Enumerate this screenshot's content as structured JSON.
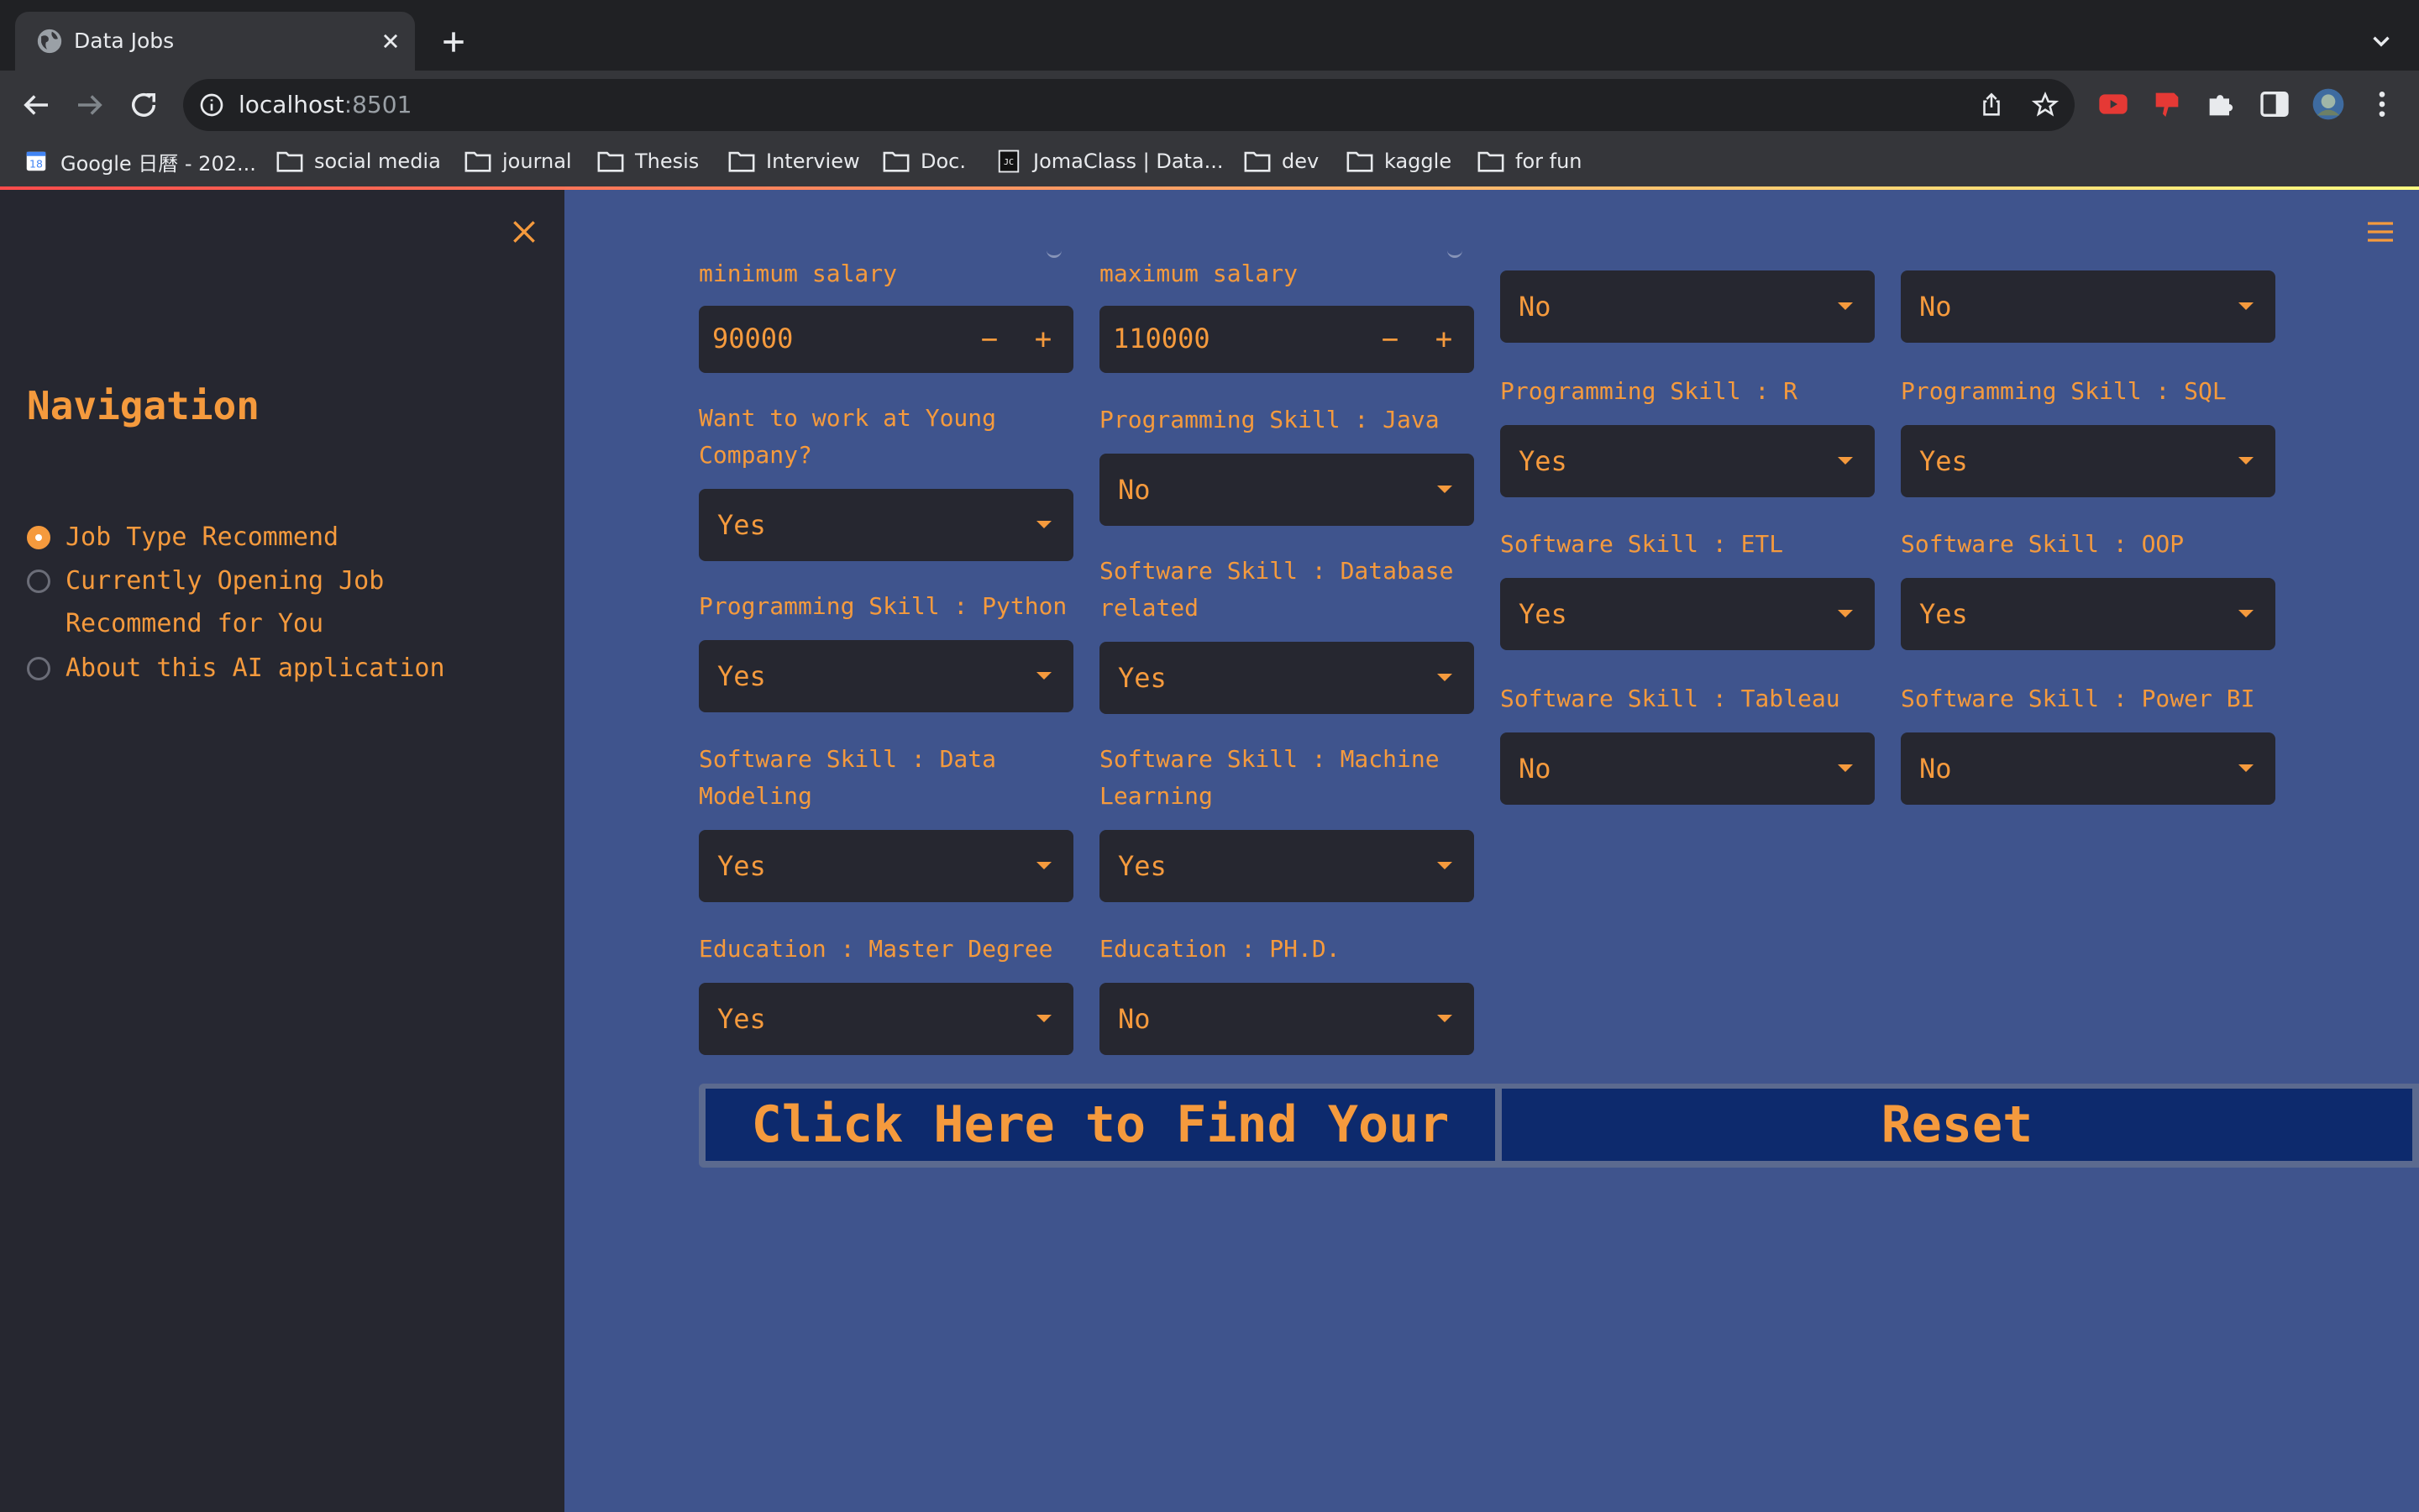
{
  "browser": {
    "tab_title": "Data Jobs",
    "url_host": "localhost",
    "url_port": ":8501",
    "bookmarks": [
      {
        "label": "Google 日曆 - 202...",
        "icon": "calendar-icon"
      },
      {
        "label": "social media",
        "icon": "folder-icon"
      },
      {
        "label": "journal",
        "icon": "folder-icon"
      },
      {
        "label": "Thesis",
        "icon": "folder-icon"
      },
      {
        "label": "Interview",
        "icon": "folder-icon"
      },
      {
        "label": "Doc.",
        "icon": "folder-icon"
      },
      {
        "label": "JomaClass | Data...",
        "icon": "jomaclass-icon"
      },
      {
        "label": "dev",
        "icon": "folder-icon"
      },
      {
        "label": "kaggle",
        "icon": "folder-icon"
      },
      {
        "label": "for fun",
        "icon": "folder-icon"
      }
    ]
  },
  "sidebar": {
    "title": "Navigation",
    "options": [
      {
        "label": "Job Type Recommend",
        "selected": true
      },
      {
        "label": "Currently Opening Job Recommend for You",
        "selected": false
      },
      {
        "label": "About this AI application",
        "selected": false
      }
    ]
  },
  "form": {
    "min_salary": {
      "label": "minimum salary",
      "value": "90000"
    },
    "max_salary": {
      "label": "maximum salary",
      "value": "110000"
    },
    "col3_top": {
      "value": "No"
    },
    "col4_top": {
      "value": "No"
    },
    "young_company": {
      "label": "Want to work at Young Company?",
      "value": "Yes"
    },
    "java": {
      "label": "Programming Skill : Java",
      "value": "No"
    },
    "r": {
      "label": "Programming Skill : R",
      "value": "Yes"
    },
    "sql": {
      "label": "Programming Skill : SQL",
      "value": "Yes"
    },
    "etl": {
      "label": "Software Skill : ETL",
      "value": "Yes"
    },
    "oop": {
      "label": "Software Skill : OOP",
      "value": "Yes"
    },
    "python": {
      "label": "Programming Skill : Python",
      "value": "Yes"
    },
    "database": {
      "label": "Software Skill : Database related",
      "value": "Yes"
    },
    "tableau": {
      "label": "Software Skill : Tableau",
      "value": "No"
    },
    "powerbi": {
      "label": "Software Skill : Power BI",
      "value": "No"
    },
    "data_modeling": {
      "label": "Software Skill : Data Modeling",
      "value": "Yes"
    },
    "ml": {
      "label": "Software Skill : Machine Learning",
      "value": "Yes"
    },
    "master": {
      "label": "Education : Master Degree",
      "value": "Yes"
    },
    "phd": {
      "label": "Education : PH.D.",
      "value": "No"
    }
  },
  "actions": {
    "find_label": "Click Here to Find Your",
    "reset_label": "Reset"
  },
  "colors": {
    "accent": "#f59a3d",
    "main_bg": "#3f548d",
    "sidebar_bg": "#262730",
    "input_bg": "#262730",
    "button_bg": "#0d2a6d"
  }
}
